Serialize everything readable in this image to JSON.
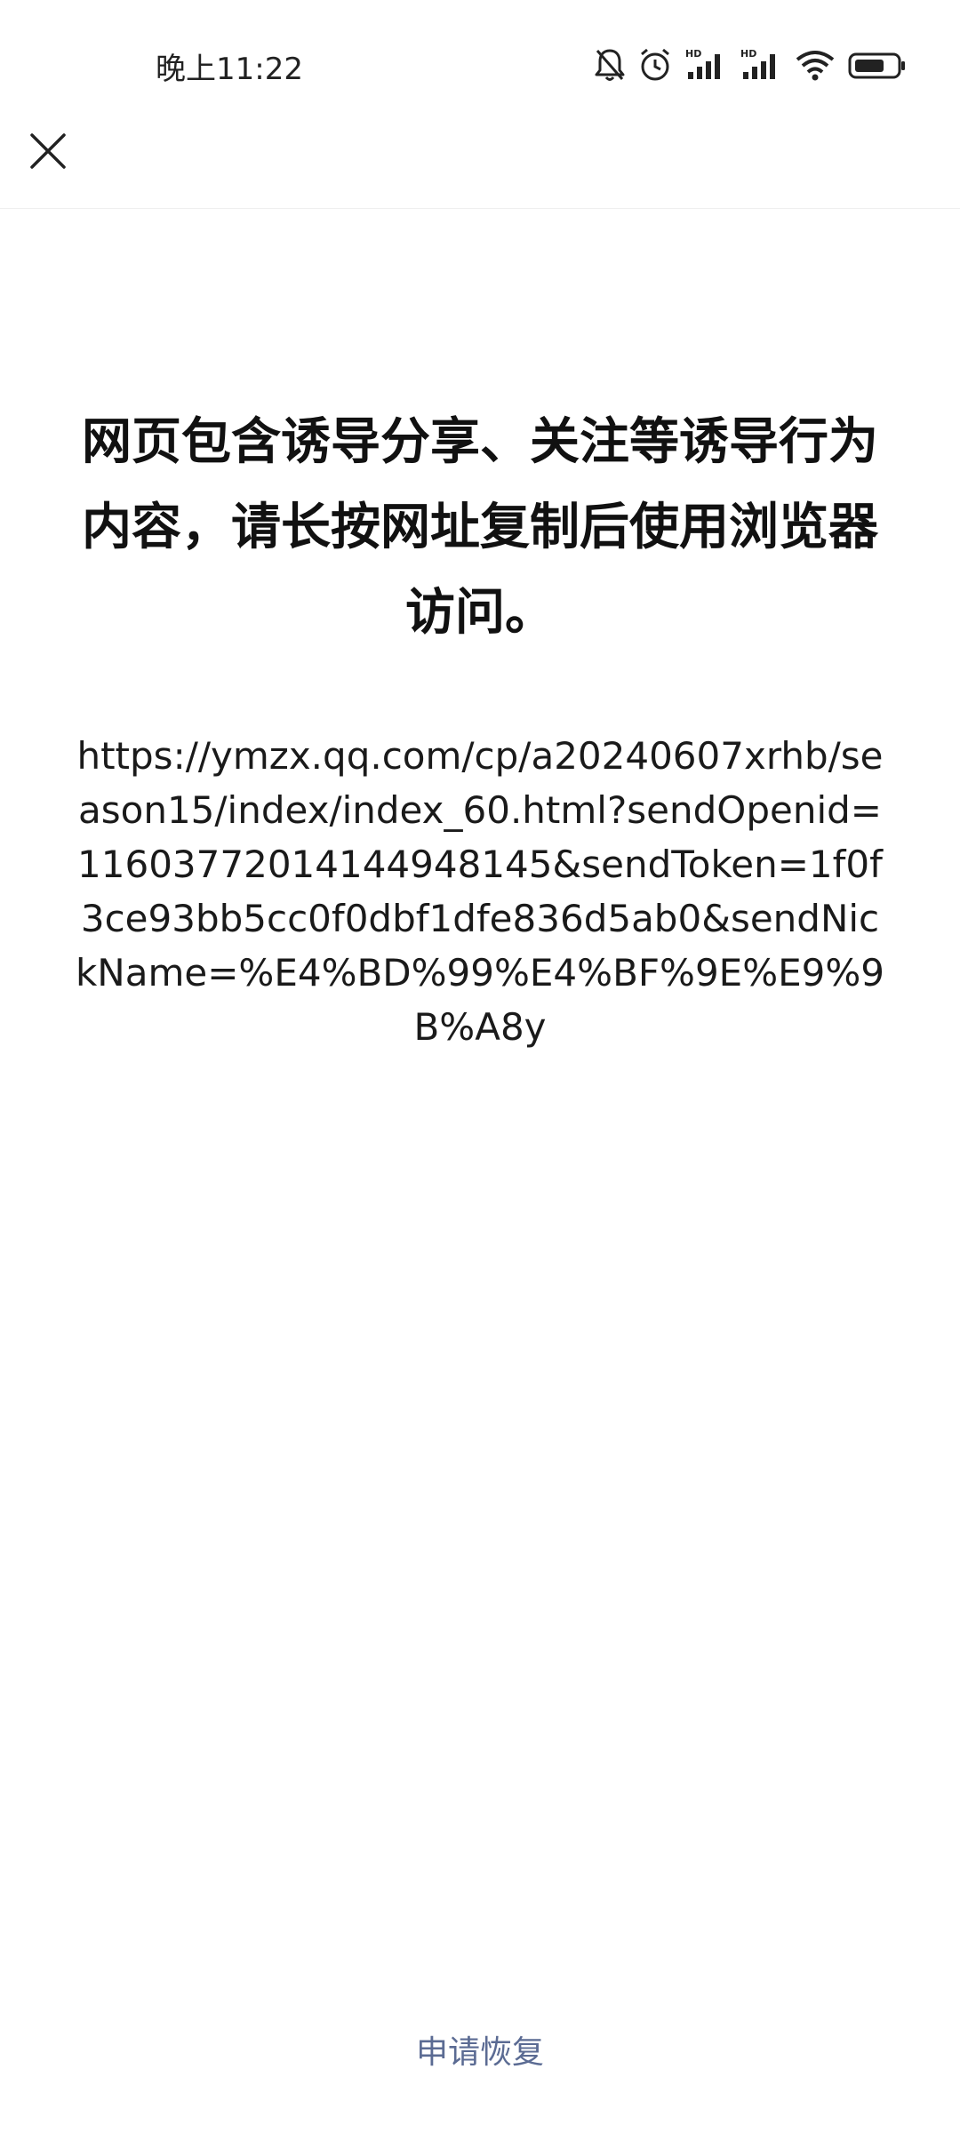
{
  "status_bar": {
    "time": "晚上11:22",
    "icons": [
      "bell-off-icon",
      "alarm-icon",
      "hd-signal-icon",
      "hd-signal-icon",
      "wifi-icon",
      "battery-icon"
    ],
    "hd_label": "HD"
  },
  "nav": {
    "close_icon": "close-icon"
  },
  "main": {
    "warning": "网页包含诱导分享、关注等诱导行为内容，请长按网址复制后使用浏览器访问。",
    "url": "https://ymzx.qq.com/cp/a20240607xrhb/season15/index/index_60.html?sendOpenid=11603772014144948145&sendToken=1f0f3ce93bb5cc0f0dbf1dfe836d5ab0&sendNickName=%E4%BD%99%E4%BF%9E%E9%9B%A8y"
  },
  "footer": {
    "appeal_label": "申请恢复"
  },
  "colors": {
    "link": "#5b6b93",
    "text": "#1a1a1a",
    "background": "#ffffff"
  }
}
